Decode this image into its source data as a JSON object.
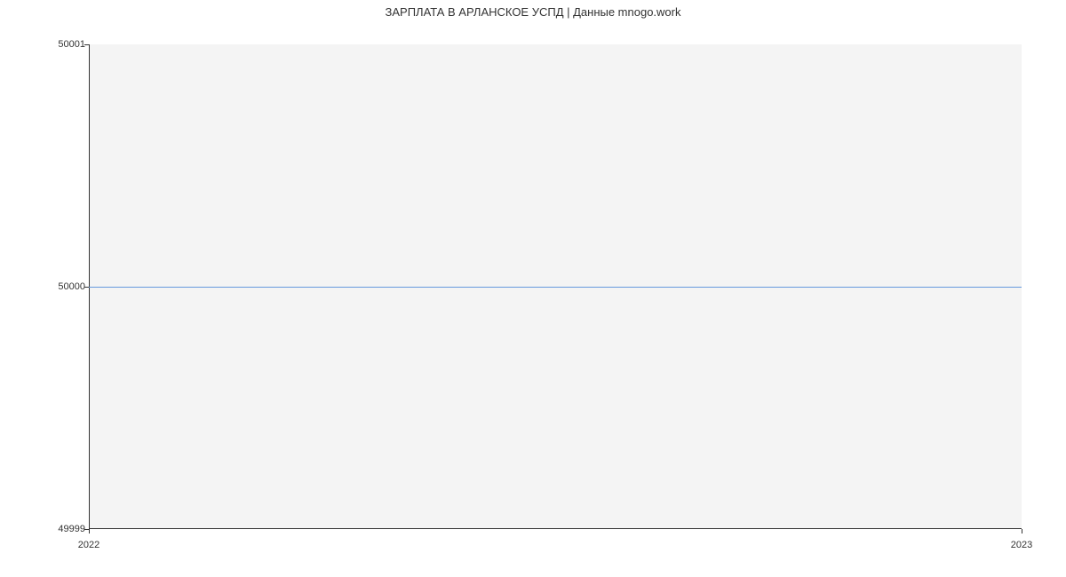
{
  "chart_data": {
    "type": "line",
    "title": "ЗАРПЛАТА В АРЛАНСКОЕ УСПД | Данные mnogo.work",
    "xlabel": "",
    "ylabel": "",
    "x": [
      "2022",
      "2023"
    ],
    "values": [
      50000,
      50000
    ],
    "xlim": [
      "2022",
      "2023"
    ],
    "ylim": [
      49999,
      50001
    ],
    "y_ticks": [
      49999,
      50000,
      50001
    ],
    "x_ticks": [
      "2022",
      "2023"
    ]
  }
}
